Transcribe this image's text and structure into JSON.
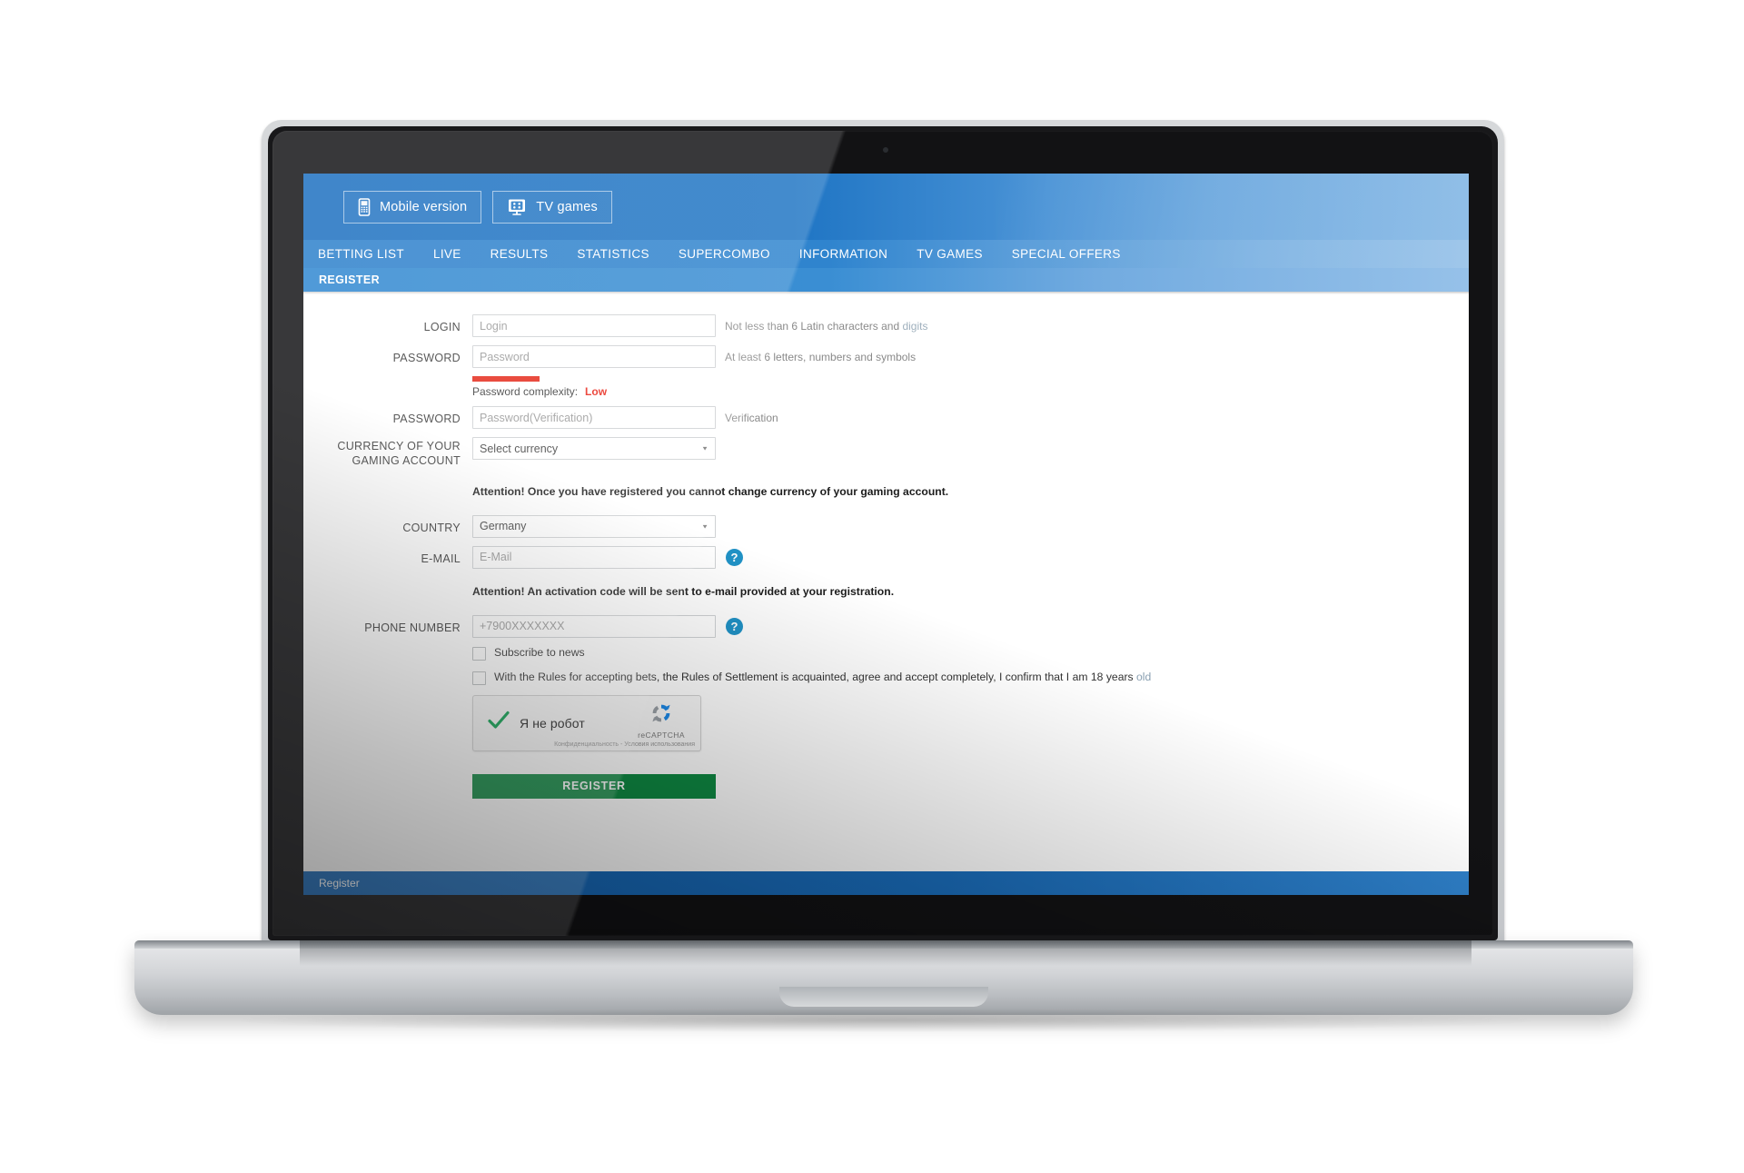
{
  "header": {
    "mobile_button": "Mobile version",
    "tv_button": "TV games",
    "mobile_icon": "mobile-phone-icon",
    "tv_icon": "tv-dice-icon"
  },
  "nav": {
    "items": [
      {
        "label": "BETTING LIST"
      },
      {
        "label": "LIVE"
      },
      {
        "label": "RESULTS"
      },
      {
        "label": "STATISTICS"
      },
      {
        "label": "SUPERCOMBO"
      },
      {
        "label": "INFORMATION"
      },
      {
        "label": "TV GAMES"
      },
      {
        "label": "SPECIAL OFFERS"
      }
    ]
  },
  "subbar": {
    "title": "REGISTER"
  },
  "form": {
    "login": {
      "label": "LOGIN",
      "placeholder": "Login",
      "value": "",
      "hint_main": "Not less than 6 Latin characters and ",
      "hint_soft": "digits"
    },
    "password": {
      "label": "PASSWORD",
      "placeholder": "Password",
      "value": "",
      "hint": "At least 6 letters, numbers and symbols"
    },
    "complexity": {
      "label": "Password complexity:",
      "value": "Low",
      "bar_color": "#e52a1a"
    },
    "password_verify": {
      "label": "PASSWORD",
      "placeholder": "Password(Verification)",
      "value": "",
      "hint": "Verification"
    },
    "currency": {
      "label": "CURRENCY OF YOUR GAMING ACCOUNT",
      "selected": "Select currency"
    },
    "currency_note": "Attention! Once you have registered you cannot change currency of your gaming account.",
    "country": {
      "label": "COUNTRY",
      "selected": "Germany"
    },
    "email": {
      "label": "E-MAIL",
      "placeholder": "E-Mail",
      "value": "",
      "help_icon": "question-mark-icon"
    },
    "email_note": "Attention! An activation code will be sent to e-mail provided at your registration.",
    "phone": {
      "label": "PHONE NUMBER",
      "placeholder": "+7900XXXXXXX",
      "value": "",
      "help_icon": "question-mark-icon"
    },
    "subscribe_checkbox": {
      "label": "Subscribe to news",
      "checked": false
    },
    "terms_checkbox": {
      "label_main": "With the Rules for accepting bets, the Rules of Settlement is acquainted, agree and accept completely, I confirm that I am 18 years ",
      "label_soft": "old",
      "checked": false
    },
    "captcha": {
      "label": "Я не робот",
      "brand": "reCAPTCHA",
      "legal": "Конфиденциальность - Условия использования",
      "check_icon": "green-checkmark-icon",
      "logo_icon": "recaptcha-logo-icon",
      "checked": true
    },
    "submit_button": "REGISTER"
  },
  "statusbar": {
    "text": "Register"
  },
  "colors": {
    "brand_blue": "#1f75c4",
    "nav_blue": "#2f84ce",
    "submit_green": "#0f8a43",
    "alert_red": "#e52a1a",
    "help_teal": "#2092c6"
  }
}
